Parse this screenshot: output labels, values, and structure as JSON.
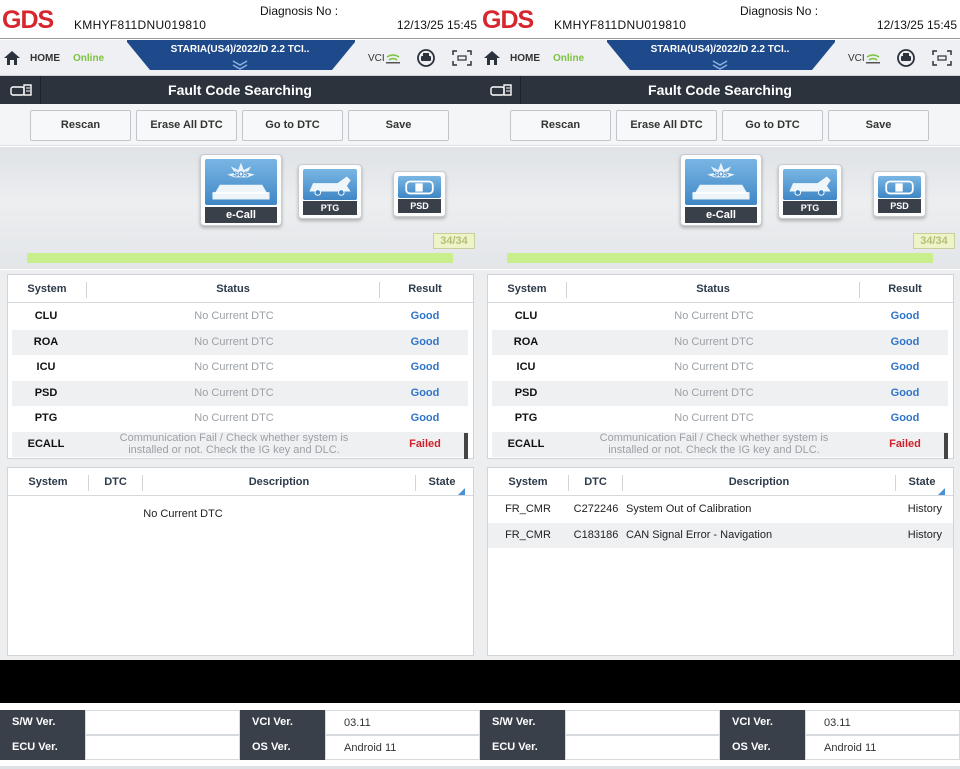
{
  "panels": [
    {
      "header": {
        "vin": "KMHYF811DNU019810",
        "diagnosis_label": "Diagnosis No :",
        "datetime": "12/13/25 15:45"
      },
      "nav": {
        "home": "HOME",
        "status": "Online",
        "vehicle": "STARIA(US4)/2022/D 2.2 TCI..",
        "vci": "VCI"
      },
      "title": "Fault Code Searching",
      "buttons": [
        "Rescan",
        "Erase All DTC",
        "Go to DTC",
        "Save"
      ],
      "modules": [
        "e-Call",
        "PTG",
        "PSD"
      ],
      "ecall_badge": "SOS",
      "counter": "34/34",
      "progress": 1.0,
      "system_table": {
        "headers": [
          "System",
          "Status",
          "Result"
        ],
        "rows": [
          {
            "system": "CLU",
            "status": "No Current DTC",
            "result": "Good",
            "ok": true
          },
          {
            "system": "ROA",
            "status": "No Current DTC",
            "result": "Good",
            "ok": true
          },
          {
            "system": "ICU",
            "status": "No Current DTC",
            "result": "Good",
            "ok": true
          },
          {
            "system": "PSD",
            "status": "No Current DTC",
            "result": "Good",
            "ok": true
          },
          {
            "system": "PTG",
            "status": "No Current DTC",
            "result": "Good",
            "ok": true
          },
          {
            "system": "ECALL",
            "status": "Communication Fail / Check whether system is installed or not. Check the IG key and DLC.",
            "result": "Failed",
            "ok": false
          }
        ]
      },
      "dtc_table": {
        "headers": [
          "System",
          "DTC",
          "Description",
          "State"
        ],
        "empty_text": "No Current DTC",
        "rows": []
      }
    },
    {
      "header": {
        "vin": "KMHYF811DNU019810",
        "diagnosis_label": "Diagnosis No :",
        "datetime": "12/13/25 15:45"
      },
      "nav": {
        "home": "HOME",
        "status": "Online",
        "vehicle": "STARIA(US4)/2022/D 2.2 TCI..",
        "vci": "VCI"
      },
      "title": "Fault Code Searching",
      "buttons": [
        "Rescan",
        "Erase All DTC",
        "Go to DTC",
        "Save"
      ],
      "modules": [
        "e-Call",
        "PTG",
        "PSD"
      ],
      "ecall_badge": "SOS",
      "counter": "34/34",
      "progress": 1.0,
      "system_table": {
        "headers": [
          "System",
          "Status",
          "Result"
        ],
        "rows": [
          {
            "system": "CLU",
            "status": "No Current DTC",
            "result": "Good",
            "ok": true
          },
          {
            "system": "ROA",
            "status": "No Current DTC",
            "result": "Good",
            "ok": true
          },
          {
            "system": "ICU",
            "status": "No Current DTC",
            "result": "Good",
            "ok": true
          },
          {
            "system": "PSD",
            "status": "No Current DTC",
            "result": "Good",
            "ok": true
          },
          {
            "system": "PTG",
            "status": "No Current DTC",
            "result": "Good",
            "ok": true
          },
          {
            "system": "ECALL",
            "status": "Communication Fail / Check whether system is installed or not. Check the IG key and DLC.",
            "result": "Failed",
            "ok": false
          }
        ]
      },
      "dtc_table": {
        "headers": [
          "System",
          "DTC",
          "Description",
          "State"
        ],
        "empty_text": "",
        "rows": [
          {
            "system": "FR_CMR",
            "dtc": "C272246",
            "description": "System Out of Calibration",
            "state": "History"
          },
          {
            "system": "FR_CMR",
            "dtc": "C183186",
            "description": "CAN Signal Error - Navigation",
            "state": "History"
          }
        ]
      }
    }
  ],
  "footer": [
    {
      "sw_label": "S/W Ver.",
      "sw_value": "",
      "vci_label": "VCI Ver.",
      "vci_value": "03.11",
      "ecu_label": "ECU Ver.",
      "ecu_value": "",
      "os_label": "OS Ver.",
      "os_value": "Android 11"
    },
    {
      "sw_label": "S/W Ver.",
      "sw_value": "",
      "vci_label": "VCI Ver.",
      "vci_value": "03.11",
      "ecu_label": "ECU Ver.",
      "ecu_value": "",
      "os_label": "OS Ver.",
      "os_value": "Android 11"
    }
  ],
  "colors": {
    "brand_red": "#d7262e",
    "nav_blue": "#1e4a8c",
    "online_green": "#7cc43f",
    "good_blue": "#2f74c8",
    "failed_red": "#d0202a",
    "dark_bar": "#2c333d"
  },
  "icons": {
    "home": "home-icon",
    "vci": "wifi-icon",
    "car": "car-diagnose-icon",
    "scan": "screen-capture-icon",
    "title": "vehicle-id-icon"
  }
}
